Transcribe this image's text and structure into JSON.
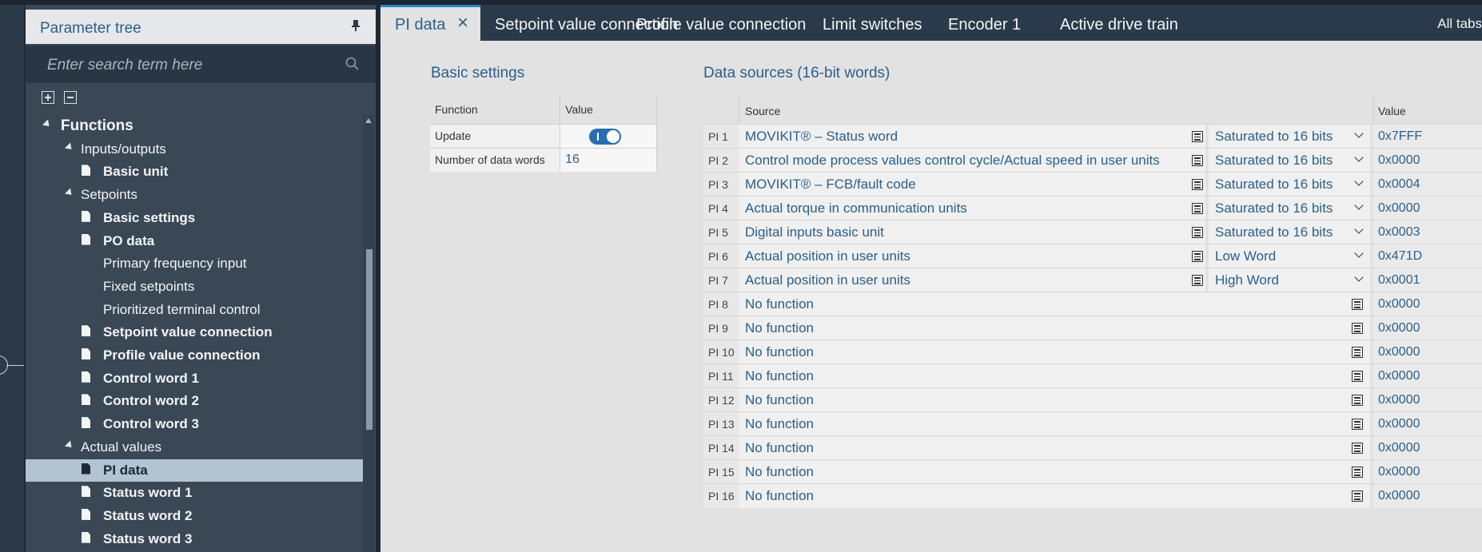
{
  "panel": {
    "title": "Parameter tree",
    "search_placeholder": "Enter search term here"
  },
  "tree": [
    {
      "label": "Functions",
      "level": 0,
      "kind": "folder",
      "bold": true
    },
    {
      "label": "Inputs/outputs",
      "level": 1,
      "kind": "folder"
    },
    {
      "label": "Basic unit",
      "level": 2,
      "kind": "doc",
      "bold": true
    },
    {
      "label": "Setpoints",
      "level": 1,
      "kind": "folder"
    },
    {
      "label": "Basic settings",
      "level": 2,
      "kind": "doc",
      "bold": true
    },
    {
      "label": "PO data",
      "level": 2,
      "kind": "doc",
      "bold": true
    },
    {
      "label": "Primary frequency input",
      "level": 2,
      "kind": "plain"
    },
    {
      "label": "Fixed setpoints",
      "level": 2,
      "kind": "plain"
    },
    {
      "label": "Prioritized terminal control",
      "level": 2,
      "kind": "plain"
    },
    {
      "label": "Setpoint value connection",
      "level": 2,
      "kind": "doc",
      "bold": true
    },
    {
      "label": "Profile value connection",
      "level": 2,
      "kind": "doc",
      "bold": true
    },
    {
      "label": "Control word 1",
      "level": 2,
      "kind": "doc",
      "bold": true
    },
    {
      "label": "Control word 2",
      "level": 2,
      "kind": "doc",
      "bold": true
    },
    {
      "label": "Control word 3",
      "level": 2,
      "kind": "doc",
      "bold": true
    },
    {
      "label": "Actual values",
      "level": 1,
      "kind": "folder"
    },
    {
      "label": "PI data",
      "level": 2,
      "kind": "doc",
      "bold": true,
      "selected": true
    },
    {
      "label": "Status word 1",
      "level": 2,
      "kind": "doc",
      "bold": true
    },
    {
      "label": "Status word 2",
      "level": 2,
      "kind": "doc",
      "bold": true
    },
    {
      "label": "Status word 3",
      "level": 2,
      "kind": "doc",
      "bold": true
    }
  ],
  "tabs": [
    "PI data",
    "Setpoint value connection",
    "Profile value connection",
    "Limit switches",
    "Encoder 1",
    "Active drive train"
  ],
  "all_tabs_label": "All tabs",
  "basic_settings": {
    "title": "Basic settings",
    "col_function": "Function",
    "col_value": "Value",
    "rows": [
      {
        "function": "Update",
        "value": "on"
      },
      {
        "function": "Number of data words",
        "value": "16"
      }
    ]
  },
  "data_sources": {
    "title": "Data sources (16-bit words)",
    "col_source": "Source",
    "col_value": "Value",
    "rows": [
      {
        "pi": "PI 1",
        "source": "MOVIKIT® – Status word",
        "format": "Saturated to 16 bits",
        "value": "0x7FFF"
      },
      {
        "pi": "PI 2",
        "source": "Control mode process values control cycle/Actual speed in user units",
        "format": "Saturated to 16 bits",
        "value": "0x0000"
      },
      {
        "pi": "PI 3",
        "source": "MOVIKIT® – FCB/fault code",
        "format": "Saturated to 16 bits",
        "value": "0x0004"
      },
      {
        "pi": "PI 4",
        "source": "Actual torque in communication units",
        "format": "Saturated to 16 bits",
        "value": "0x0000"
      },
      {
        "pi": "PI 5",
        "source": "Digital inputs basic unit",
        "format": "Saturated to 16 bits",
        "value": "0x0003"
      },
      {
        "pi": "PI 6",
        "source": "Actual position in user units",
        "format": "Low Word",
        "value": "0x471D"
      },
      {
        "pi": "PI 7",
        "source": "Actual position in user units",
        "format": "High Word",
        "value": "0x0001"
      },
      {
        "pi": "PI 8",
        "source": "No function",
        "format": "",
        "value": "0x0000"
      },
      {
        "pi": "PI 9",
        "source": "No function",
        "format": "",
        "value": "0x0000"
      },
      {
        "pi": "PI 10",
        "source": "No function",
        "format": "",
        "value": "0x0000"
      },
      {
        "pi": "PI 11",
        "source": "No function",
        "format": "",
        "value": "0x0000"
      },
      {
        "pi": "PI 12",
        "source": "No function",
        "format": "",
        "value": "0x0000"
      },
      {
        "pi": "PI 13",
        "source": "No function",
        "format": "",
        "value": "0x0000"
      },
      {
        "pi": "PI 14",
        "source": "No function",
        "format": "",
        "value": "0x0000"
      },
      {
        "pi": "PI 15",
        "source": "No function",
        "format": "",
        "value": "0x0000"
      },
      {
        "pi": "PI 16",
        "source": "No function",
        "format": "",
        "value": "0x0000"
      }
    ]
  }
}
